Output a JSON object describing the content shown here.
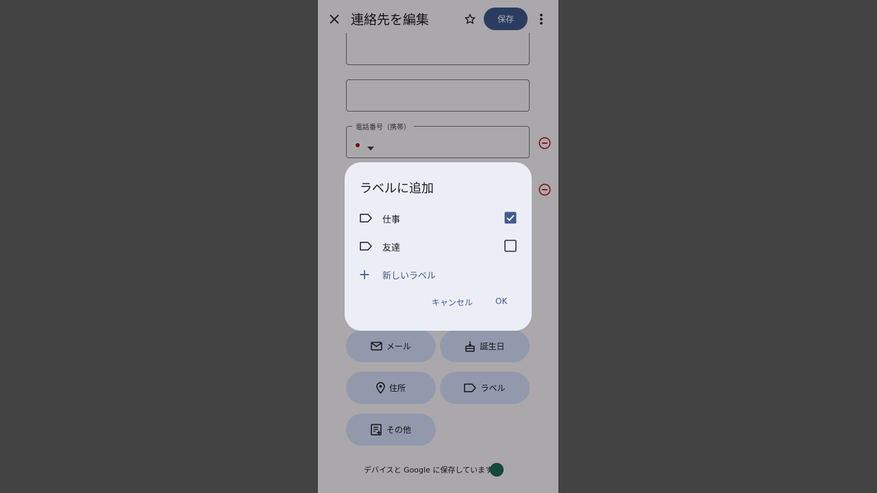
{
  "header": {
    "title": "連絡先を編集",
    "save_label": "保存"
  },
  "form": {
    "phone_label": "電話番号（携帯）"
  },
  "chips": {
    "email": "メール",
    "birthday": "誕生日",
    "address": "住所",
    "label": "ラベル",
    "other": "その他"
  },
  "footer": {
    "text": "デバイスと Google に保存しています"
  },
  "dialog": {
    "title": "ラベルに追加",
    "options": [
      {
        "label": "仕事",
        "checked": true
      },
      {
        "label": "友達",
        "checked": false
      }
    ],
    "new_label": "新しいラベル",
    "cancel_label": "キャンセル",
    "ok_label": "OK"
  },
  "colors": {
    "accent": "#3f5a8f",
    "chip_bg": "#d8e2ff",
    "remove": "#ba1a1a",
    "avatar": "#1e6b54"
  }
}
